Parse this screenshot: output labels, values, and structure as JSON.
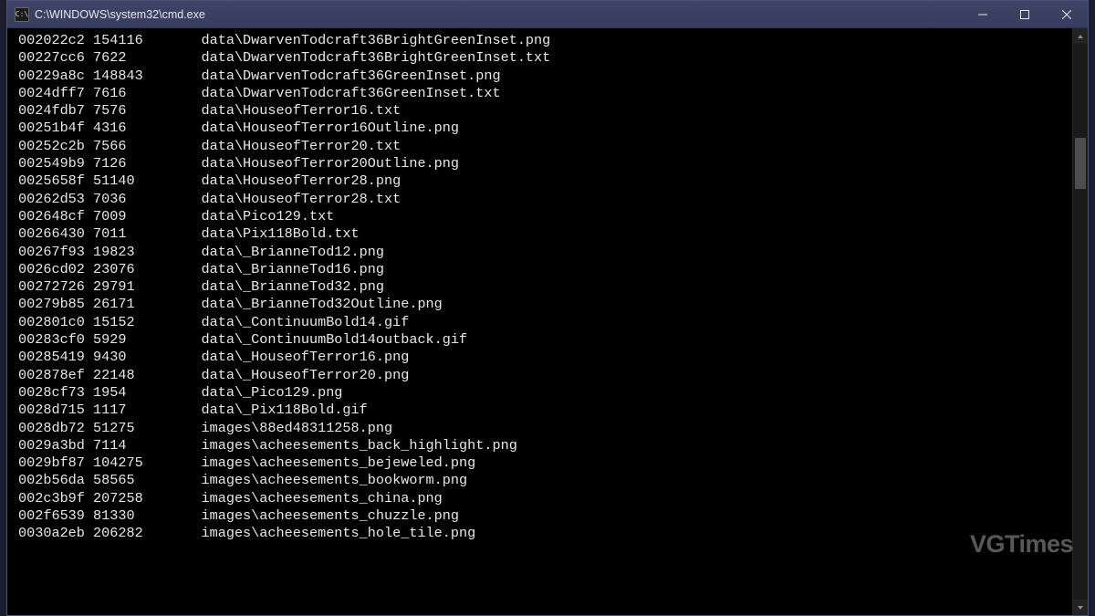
{
  "window": {
    "icon_label": "C:\\",
    "title": "C:\\WINDOWS\\system32\\cmd.exe"
  },
  "watermark": "VGTimes",
  "listing": [
    {
      "addr": "002022c2",
      "size": "154116",
      "path": "data\\DwarvenTodcraft36BrightGreenInset.png"
    },
    {
      "addr": "00227cc6",
      "size": "7622",
      "path": "data\\DwarvenTodcraft36BrightGreenInset.txt"
    },
    {
      "addr": "00229a8c",
      "size": "148843",
      "path": "data\\DwarvenTodcraft36GreenInset.png"
    },
    {
      "addr": "0024dff7",
      "size": "7616",
      "path": "data\\DwarvenTodcraft36GreenInset.txt"
    },
    {
      "addr": "0024fdb7",
      "size": "7576",
      "path": "data\\HouseofTerror16.txt"
    },
    {
      "addr": "00251b4f",
      "size": "4316",
      "path": "data\\HouseofTerror16Outline.png"
    },
    {
      "addr": "00252c2b",
      "size": "7566",
      "path": "data\\HouseofTerror20.txt"
    },
    {
      "addr": "002549b9",
      "size": "7126",
      "path": "data\\HouseofTerror20Outline.png"
    },
    {
      "addr": "0025658f",
      "size": "51140",
      "path": "data\\HouseofTerror28.png"
    },
    {
      "addr": "00262d53",
      "size": "7036",
      "path": "data\\HouseofTerror28.txt"
    },
    {
      "addr": "002648cf",
      "size": "7009",
      "path": "data\\Pico129.txt"
    },
    {
      "addr": "00266430",
      "size": "7011",
      "path": "data\\Pix118Bold.txt"
    },
    {
      "addr": "00267f93",
      "size": "19823",
      "path": "data\\_BrianneTod12.png"
    },
    {
      "addr": "0026cd02",
      "size": "23076",
      "path": "data\\_BrianneTod16.png"
    },
    {
      "addr": "00272726",
      "size": "29791",
      "path": "data\\_BrianneTod32.png"
    },
    {
      "addr": "00279b85",
      "size": "26171",
      "path": "data\\_BrianneTod32Outline.png"
    },
    {
      "addr": "002801c0",
      "size": "15152",
      "path": "data\\_ContinuumBold14.gif"
    },
    {
      "addr": "00283cf0",
      "size": "5929",
      "path": "data\\_ContinuumBold14outback.gif"
    },
    {
      "addr": "00285419",
      "size": "9430",
      "path": "data\\_HouseofTerror16.png"
    },
    {
      "addr": "002878ef",
      "size": "22148",
      "path": "data\\_HouseofTerror20.png"
    },
    {
      "addr": "0028cf73",
      "size": "1954",
      "path": "data\\_Pico129.png"
    },
    {
      "addr": "0028d715",
      "size": "1117",
      "path": "data\\_Pix118Bold.gif"
    },
    {
      "addr": "0028db72",
      "size": "51275",
      "path": "images\\88ed48311258.png"
    },
    {
      "addr": "0029a3bd",
      "size": "7114",
      "path": "images\\acheesements_back_highlight.png"
    },
    {
      "addr": "0029bf87",
      "size": "104275",
      "path": "images\\acheesements_bejeweled.png"
    },
    {
      "addr": "002b56da",
      "size": "58565",
      "path": "images\\acheesements_bookworm.png"
    },
    {
      "addr": "002c3b9f",
      "size": "207258",
      "path": "images\\acheesements_china.png"
    },
    {
      "addr": "002f6539",
      "size": "81330",
      "path": "images\\acheesements_chuzzle.png"
    },
    {
      "addr": "0030a2eb",
      "size": "206282",
      "path": "images\\acheesements_hole_tile.png"
    }
  ]
}
